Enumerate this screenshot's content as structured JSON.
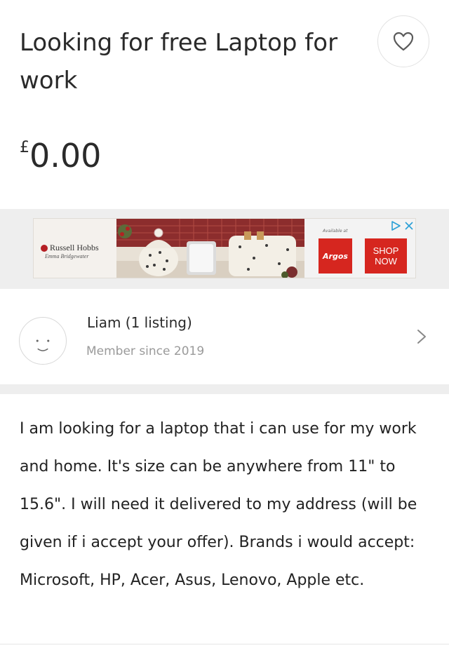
{
  "listing": {
    "title": "Looking for free Laptop for work",
    "price_currency": "£",
    "price_amount": "0.00"
  },
  "ad": {
    "brand_line1": "Russell Hobbs",
    "brand_line2": "Emma Bridgewater",
    "available_at": "Available at",
    "retailer": "Argos",
    "cta": "SHOP NOW"
  },
  "seller": {
    "name": "Liam (1 listing)",
    "member_since": "Member since 2019"
  },
  "description": "I am looking for a laptop that i can use for my work and home. It's size can be anywhere from 11\" to 15.6\". I will need it delivered to my address (will be given if i accept your offer). Brands i would accept: Microsoft, HP, Acer, Asus, Lenovo, Apple etc.",
  "icons": {
    "favorite": "heart-icon",
    "avatar": "smiley-icon",
    "chevron": "chevron-right-icon",
    "adchoices": "adchoices-icon",
    "ad_close": "close-icon"
  },
  "colors": {
    "accent_red": "#d6261f",
    "muted_text": "#9a9a9a",
    "separator": "#eeeeee"
  }
}
